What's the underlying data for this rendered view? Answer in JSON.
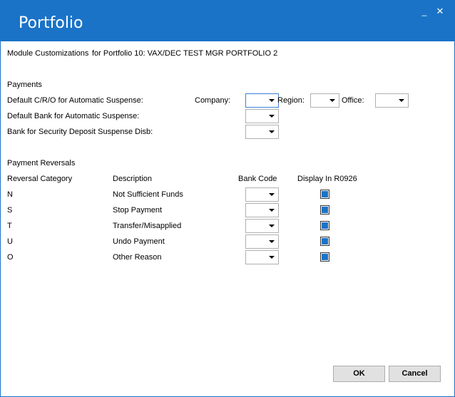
{
  "window": {
    "title": "Portfolio",
    "minimize_glyph": "_",
    "close_glyph": "✕"
  },
  "header": {
    "module_label": "Module Customizations",
    "portfolio_label": "for Portfolio 10: VAX/DEC TEST MGR PORTFOLIO 2"
  },
  "payments": {
    "section_title": "Payments",
    "default_cro_label": "Default C/R/O for Automatic Suspense:",
    "company_label": "Company:",
    "region_label": "Region:",
    "office_label": "Office:",
    "default_bank_label": "Default Bank for Automatic Suspense:",
    "security_deposit_label": "Bank for Security Deposit Suspense Disb:"
  },
  "reversals": {
    "section_title": "Payment Reversals",
    "col_category": "Reversal Category",
    "col_description": "Description",
    "col_bank_code": "Bank Code",
    "col_display": "Display In R0926",
    "rows": [
      {
        "category": "N",
        "description": "Not Sufficient Funds",
        "display_checked": true
      },
      {
        "category": "S",
        "description": "Stop Payment",
        "display_checked": true
      },
      {
        "category": "T",
        "description": "Transfer/Misapplied",
        "display_checked": true
      },
      {
        "category": "U",
        "description": "Undo Payment",
        "display_checked": true
      },
      {
        "category": "O",
        "description": "Other Reason",
        "display_checked": true
      }
    ]
  },
  "footer": {
    "ok_label": "OK",
    "cancel_label": "Cancel"
  },
  "colors": {
    "accent": "#1a73c7"
  }
}
